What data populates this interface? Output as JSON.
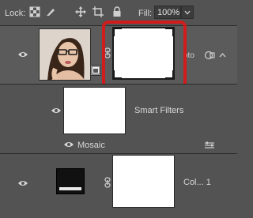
{
  "toolbar": {
    "lock_label": "Lock:",
    "lock_icons": [
      "lock-transparent-pixels-icon",
      "lock-image-pixels-icon",
      "lock-position-icon",
      "lock-artboard-icon",
      "lock-all-icon"
    ],
    "fill_label": "Fill:",
    "fill_value": "100%"
  },
  "layers": [
    {
      "name": "oto",
      "visible": true,
      "type": "smart-object",
      "thumbnail": "photo-woman-with-glasses",
      "has_layer_mask": true,
      "mask_highlighted": true,
      "highlight_color": "#d01c1c"
    },
    {
      "name": "Smart Filters",
      "visible": true,
      "type": "smart-filters-mask",
      "filters": [
        {
          "name": "Mosaic",
          "visible": true
        }
      ]
    },
    {
      "name": "Col... 1",
      "visible": true,
      "type": "solid-color-fill"
    }
  ]
}
